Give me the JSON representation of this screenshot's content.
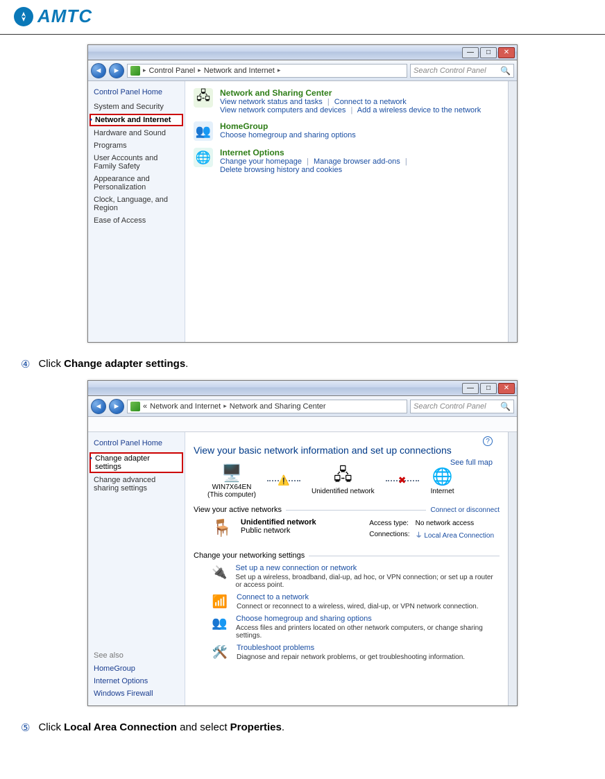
{
  "header": {
    "logo_text": "AMTC"
  },
  "instruction4": {
    "num": "④",
    "pre": "Click ",
    "bold": "Change adapter settings",
    "post": "."
  },
  "instruction5": {
    "num": "⑤",
    "pre": "Click ",
    "bold1": "Local Area Connection",
    "mid": " and select ",
    "bold2": "Properties",
    "post": "."
  },
  "win1": {
    "titlebar_min": "—",
    "titlebar_max": "□",
    "titlebar_close": "✕",
    "back": "◄",
    "fwd": "►",
    "crumb1": "Control Panel",
    "crumb2": "Network and Internet",
    "search_placeholder": "Search Control Panel",
    "side_head": "Control Panel Home",
    "side_items": [
      "System and Security",
      "Network and Internet",
      "Hardware and Sound",
      "Programs",
      "User Accounts and Family Safety",
      "Appearance and Personalization",
      "Clock, Language, and Region",
      "Ease of Access"
    ],
    "cat1": {
      "title": "Network and Sharing Center",
      "link1": "View network status and tasks",
      "link2": "Connect to a network",
      "link3": "View network computers and devices",
      "link4": "Add a wireless device to the network"
    },
    "cat2": {
      "title": "HomeGroup",
      "link1": "Choose homegroup and sharing options"
    },
    "cat3": {
      "title": "Internet Options",
      "link1": "Change your homepage",
      "link2": "Manage browser add-ons",
      "link3": "Delete browsing history and cookies"
    }
  },
  "win2": {
    "titlebar_min": "—",
    "titlebar_max": "□",
    "titlebar_close": "✕",
    "back": "◄",
    "fwd": "►",
    "crumb_pre": "«",
    "crumb1": "Network and Internet",
    "crumb2": "Network and Sharing Center",
    "search_placeholder": "Search Control Panel",
    "side_head": "Control Panel Home",
    "side_change": "Change adapter settings",
    "side_adv": "Change advanced sharing settings",
    "seealso_label": "See also",
    "seealso_items": [
      "HomeGroup",
      "Internet Options",
      "Windows Firewall"
    ],
    "headline": "View your basic network information and set up connections",
    "seefull": "See full map",
    "map_computer": "WIN7X64EN",
    "map_computer_sub": "(This computer)",
    "map_net": "Unidentified network",
    "map_inet": "Internet",
    "active_label": "View your active networks",
    "connect_label": "Connect or disconnect",
    "net_name": "Unidentified network",
    "net_type": "Public network",
    "access_label": "Access type:",
    "access_value": "No network access",
    "conn_label": "Connections:",
    "conn_value": "Local Area Connection",
    "change_section": "Change your networking settings",
    "set1_title": "Set up a new connection or network",
    "set1_desc": "Set up a wireless, broadband, dial-up, ad hoc, or VPN connection; or set up a router or access point.",
    "set2_title": "Connect to a network",
    "set2_desc": "Connect or reconnect to a wireless, wired, dial-up, or VPN network connection.",
    "set3_title": "Choose homegroup and sharing options",
    "set3_desc": "Access files and printers located on other network computers, or change sharing settings.",
    "set4_title": "Troubleshoot problems",
    "set4_desc": "Diagnose and repair network problems, or get troubleshooting information."
  }
}
